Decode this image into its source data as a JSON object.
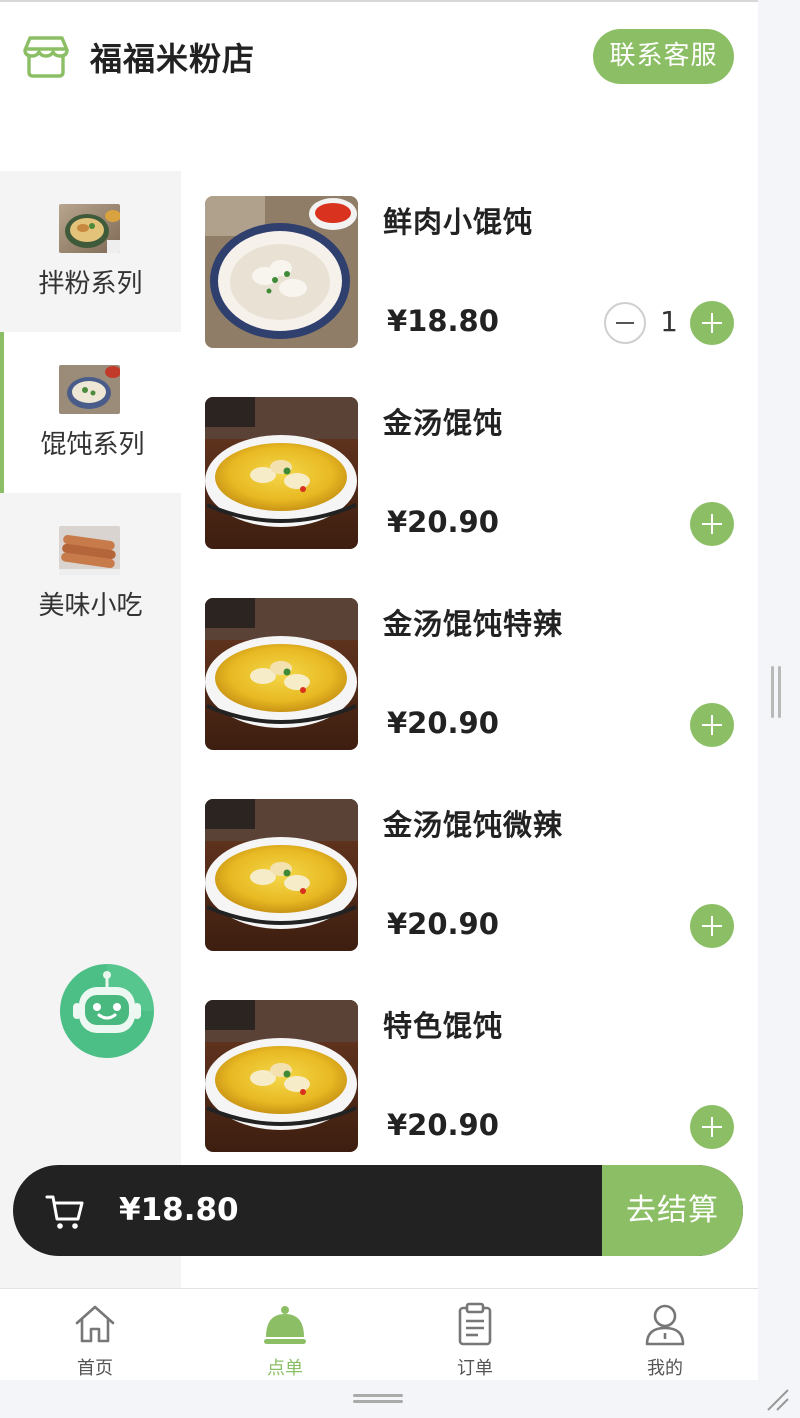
{
  "header": {
    "shop_name": "福福米粉店",
    "service_label": "联系客服"
  },
  "categories": [
    {
      "label": "拌粉系列",
      "active": false
    },
    {
      "label": "馄饨系列",
      "active": true
    },
    {
      "label": "美味小吃",
      "active": false
    }
  ],
  "products": [
    {
      "name": "鲜肉小馄饨",
      "price": "¥18.80",
      "quantity": "1"
    },
    {
      "name": "金汤馄饨",
      "price": "¥20.90"
    },
    {
      "name": "金汤馄饨特辣",
      "price": "¥20.90"
    },
    {
      "name": "金汤馄饨微辣",
      "price": "¥20.90"
    },
    {
      "name": "特色馄饨",
      "price": "¥20.90"
    }
  ],
  "cart": {
    "total": "¥18.80",
    "checkout_label": "去结算"
  },
  "tabs": [
    {
      "label": "首页",
      "icon": "home-icon"
    },
    {
      "label": "点单",
      "icon": "cloche-icon",
      "active": true
    },
    {
      "label": "订单",
      "icon": "clipboard-icon"
    },
    {
      "label": "我的",
      "icon": "user-icon"
    }
  ],
  "colors": {
    "accent": "#8cbf65",
    "cart_bar": "#222222",
    "sidebar_bg": "#f4f4f4"
  }
}
